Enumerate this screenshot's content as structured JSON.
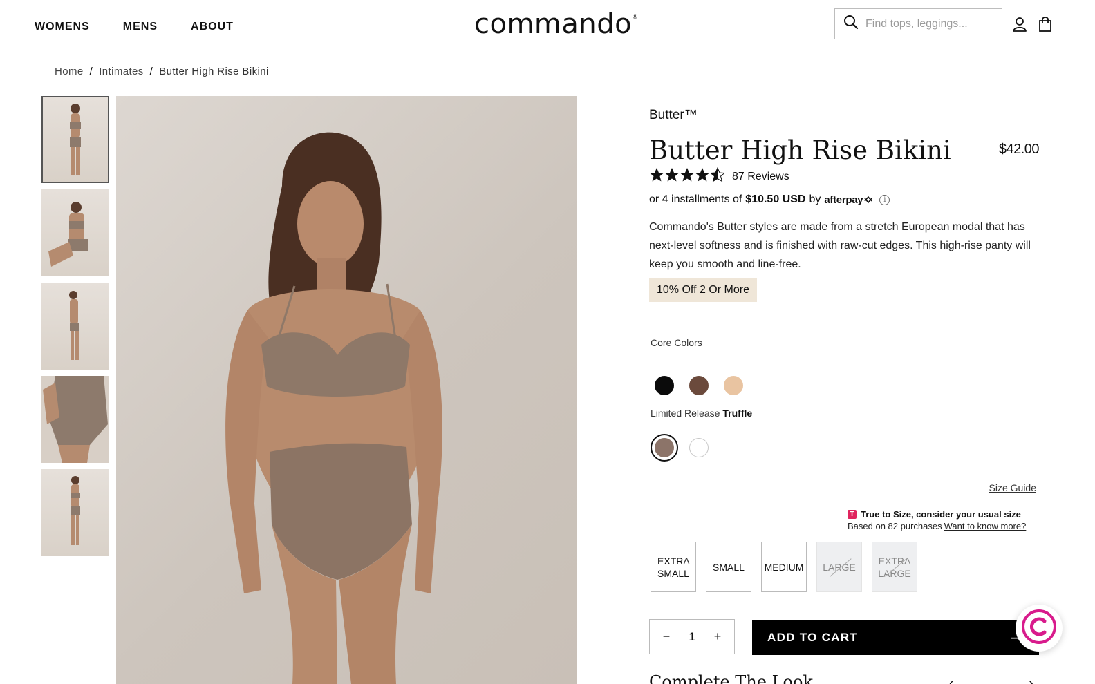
{
  "header": {
    "nav": [
      "WOMENS",
      "MENS",
      "ABOUT"
    ],
    "logo": "commando",
    "logo_mark": "®",
    "search_placeholder": "Find tops, leggings..."
  },
  "breadcrumb": {
    "items": [
      "Home",
      "Intimates",
      "Butter High Rise Bikini"
    ],
    "separator": "/"
  },
  "product": {
    "brand": "Butter™",
    "title": "Butter High Rise Bikini",
    "price": "$42.00",
    "rating_value": 4.5,
    "stars": "★★★★★",
    "reviews": "87 Reviews",
    "afterpay_prefix": "or 4 installments of",
    "afterpay_amount": "$10.50 USD",
    "afterpay_by": "by",
    "afterpay_brand": "afterpay",
    "description": "Commando's Butter styles are made from a stretch European modal that has next-level softness and is finished with raw-cut edges. This high-rise panty will keep you smooth and line-free.",
    "promo": "10% Off 2 Or More"
  },
  "colors": {
    "core_label": "Core Colors",
    "core": [
      {
        "name": "black",
        "hex": "#0b0b0b"
      },
      {
        "name": "cocoa",
        "hex": "#6b4a3c"
      },
      {
        "name": "beige",
        "hex": "#e9c4a1"
      }
    ],
    "limited_label": "Limited Release",
    "selected_name": "Truffle",
    "limited": [
      {
        "name": "truffle",
        "hex": "#8c7469",
        "selected": true
      },
      {
        "name": "white",
        "hex": "#ffffff",
        "selected": false
      }
    ]
  },
  "sizing": {
    "guide": "Size Guide",
    "fit_badge": "T",
    "fit_title": "True to Size, consider your usual size",
    "fit_basis": "Based on 82 purchases",
    "fit_link": "Want to know more?",
    "options": [
      {
        "label": "EXTRA SMALL",
        "available": true
      },
      {
        "label": "SMALL",
        "available": true
      },
      {
        "label": "MEDIUM",
        "available": true
      },
      {
        "label": "LARGE",
        "available": false
      },
      {
        "label": "EXTRA LARGE",
        "available": false
      }
    ]
  },
  "cart": {
    "quantity": "1",
    "minus": "−",
    "plus": "+",
    "add_label": "ADD TO CART",
    "add_arrow": "—"
  },
  "complete_look": {
    "title": "Complete The Look",
    "prev": "‹",
    "next": "›"
  },
  "colors_ui": {
    "accent_pink": "#e0245e",
    "promo_bg": "#efe6d8",
    "button_black": "#000000"
  }
}
